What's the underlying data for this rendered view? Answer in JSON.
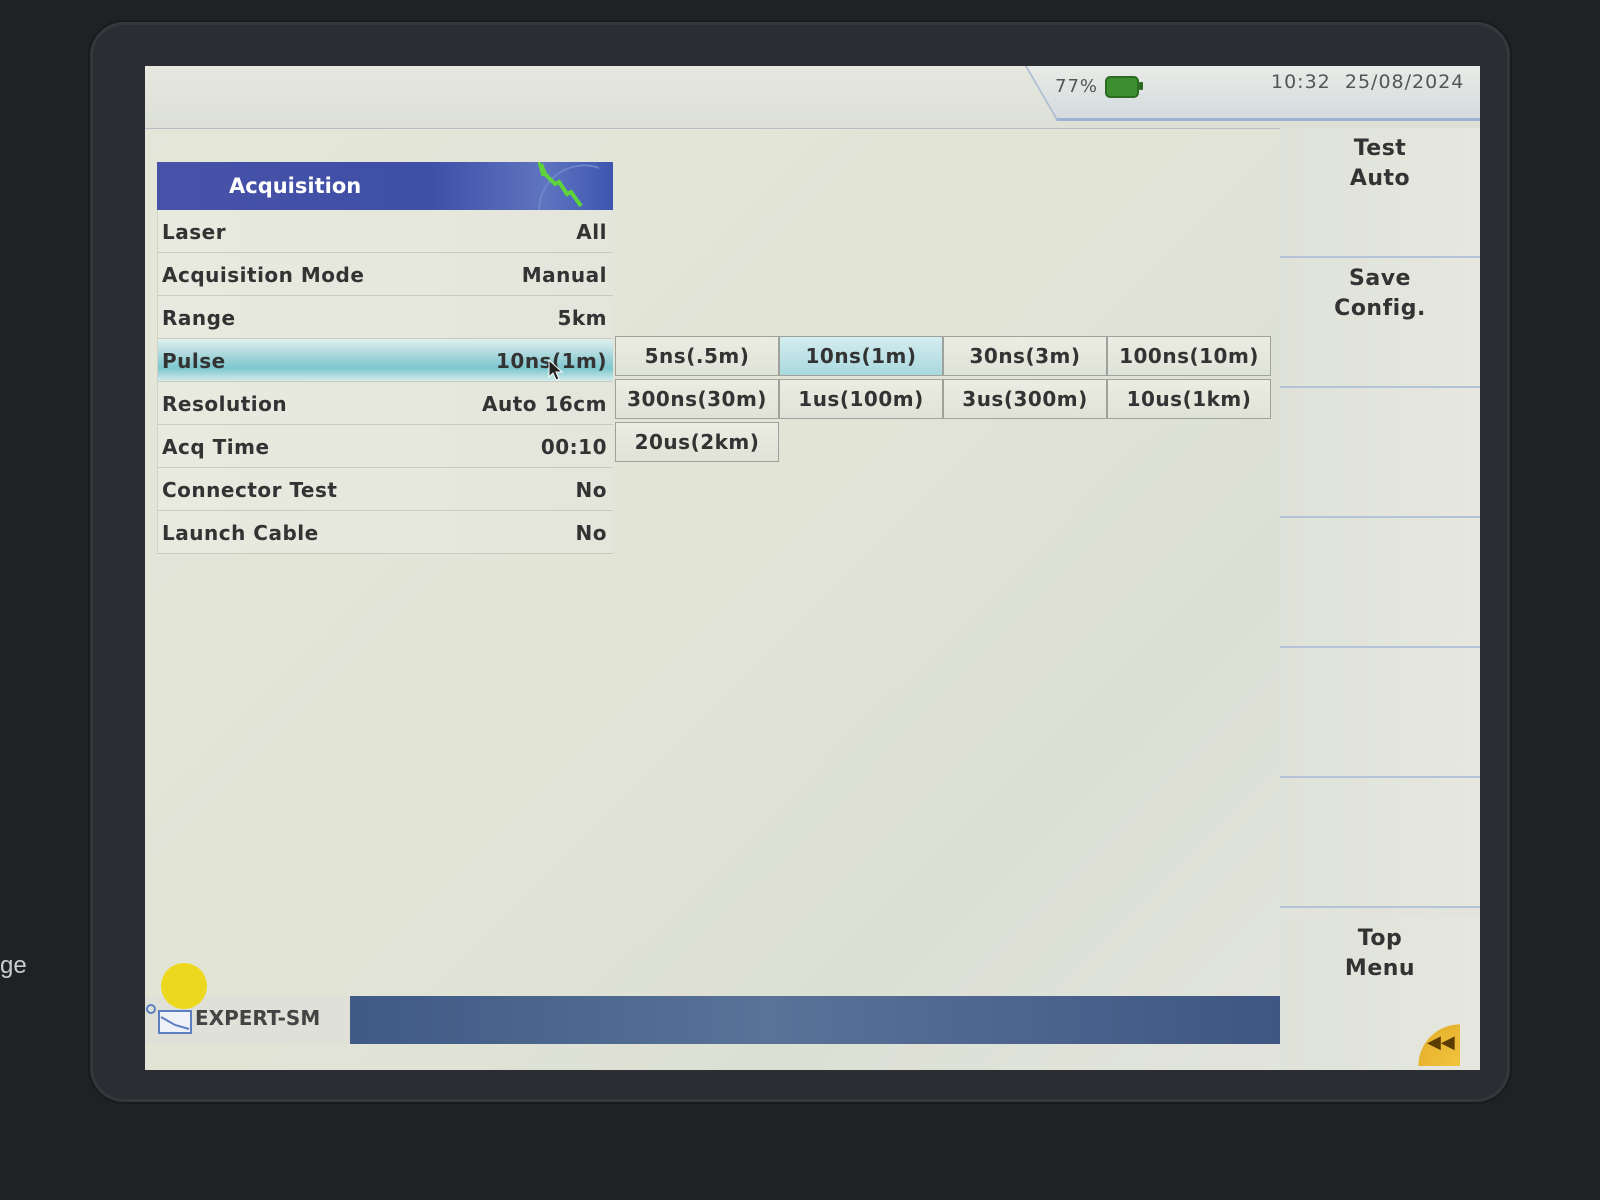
{
  "status": {
    "battery": "77%",
    "time": "10:32",
    "date": "25/08/2024"
  },
  "panel": {
    "title": "Acquisition",
    "rows": [
      {
        "label": "Laser",
        "value": "All"
      },
      {
        "label": "Acquisition Mode",
        "value": "Manual"
      },
      {
        "label": "Range",
        "value": "5km"
      },
      {
        "label": "Pulse",
        "value": "10ns(1m)"
      },
      {
        "label": "Resolution",
        "value": "Auto 16cm"
      },
      {
        "label": "Acq Time",
        "value": "00:10"
      },
      {
        "label": "Connector Test",
        "value": "No"
      },
      {
        "label": "Launch Cable",
        "value": "No"
      }
    ],
    "selected_row": "Pulse"
  },
  "pulse_options": {
    "items": [
      "5ns(.5m)",
      "10ns(1m)",
      "30ns(3m)",
      "100ns(10m)",
      "300ns(30m)",
      "1us(100m)",
      "3us(300m)",
      "10us(1km)",
      "20us(2km)"
    ],
    "selected": "10ns(1m)"
  },
  "softkeys": {
    "test_auto": [
      "Test",
      "Auto"
    ],
    "save_config": [
      "Save",
      "Config."
    ],
    "top_menu": [
      "Top",
      "Menu"
    ]
  },
  "bottom": {
    "mode": "EXPERT-SM"
  },
  "edge": {
    "text": "ge"
  },
  "colors": {
    "header_blue": "#4852a8",
    "selected_cyan": "#7cc7d0",
    "battery_green": "#3d8e2f",
    "accent_yellow": "#ecd81f"
  }
}
